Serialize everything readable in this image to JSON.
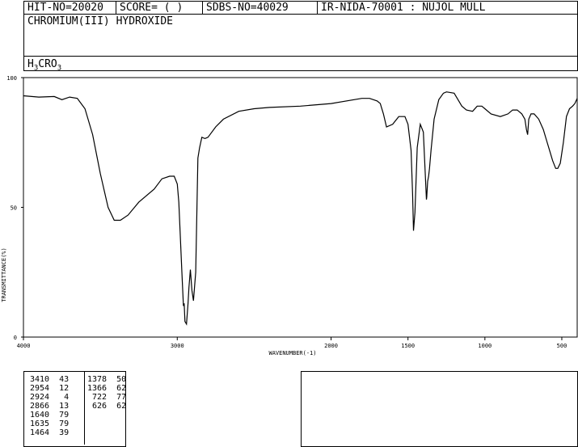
{
  "header": {
    "hit_no": "HIT-NO=20020",
    "score": "SCORE=  (   )",
    "sdbs_no": "SDBS-NO=40029",
    "ir_code": "IR-NIDA-70001 : NUJOL MULL"
  },
  "compound": {
    "name": "CHROMIUM(III) HYDROXIDE",
    "formula_main": "H",
    "formula_sub1": "3",
    "formula_mid": "CRO",
    "formula_sub2": "3"
  },
  "chart_data": {
    "type": "line",
    "xlabel": "WAVENUMBER(-1)",
    "ylabel": "TRANSMITTANCE(%)",
    "xlim": [
      4000,
      400
    ],
    "ylim": [
      0,
      100
    ],
    "x_ticks": [
      4000,
      3000,
      2000,
      1500,
      1000,
      500
    ],
    "y_ticks": [
      0,
      50,
      100
    ],
    "grid": false,
    "legend": "none",
    "series": [
      {
        "x": [
          4000,
          3900,
          3800,
          3750,
          3700,
          3650,
          3600,
          3550,
          3500,
          3450,
          3410,
          3370,
          3320,
          3250,
          3150,
          3100,
          3050,
          3020,
          3000,
          2990,
          2970,
          2960,
          2955,
          2950,
          2940,
          2930,
          2924,
          2915,
          2905,
          2895,
          2880,
          2866,
          2855,
          2840,
          2820,
          2800,
          2750,
          2700,
          2600,
          2500,
          2400,
          2200,
          2000,
          1800,
          1750,
          1700,
          1680,
          1660,
          1640,
          1600,
          1560,
          1520,
          1500,
          1480,
          1470,
          1464,
          1455,
          1440,
          1420,
          1400,
          1390,
          1380,
          1378,
          1372,
          1366,
          1360,
          1350,
          1330,
          1300,
          1270,
          1250,
          1200,
          1180,
          1150,
          1120,
          1080,
          1050,
          1020,
          1000,
          960,
          900,
          850,
          820,
          790,
          760,
          740,
          730,
          722,
          715,
          700,
          680,
          650,
          620,
          600,
          580,
          560,
          540,
          526,
          510,
          490,
          470,
          450,
          430,
          415,
          400
        ],
        "y": [
          93,
          92.5,
          92.7,
          91.5,
          92.5,
          92,
          88,
          78,
          63,
          50,
          45,
          45,
          47,
          52,
          57,
          61,
          62,
          62,
          59,
          52,
          25,
          12,
          13,
          6,
          5,
          13,
          19,
          26,
          18,
          14,
          25,
          69,
          73,
          77,
          76.5,
          77,
          81,
          84,
          87,
          88,
          88.5,
          89,
          90,
          92,
          92,
          91,
          90,
          86,
          81,
          82,
          85,
          85,
          82,
          72,
          55,
          41,
          48,
          73,
          82,
          79,
          66,
          53,
          54,
          60,
          62,
          65,
          72,
          84,
          91.5,
          94,
          94.5,
          94,
          92,
          89,
          87.5,
          87,
          89,
          89,
          88,
          86,
          85,
          86,
          87.5,
          87.5,
          86,
          84,
          80,
          78,
          84,
          86,
          86,
          84,
          80,
          76,
          72,
          68,
          65,
          65,
          67,
          75,
          85,
          88,
          89,
          90,
          92
        ]
      }
    ]
  },
  "peaks": {
    "col1": "3410  43\n2954  12\n2924   4\n2866  13\n1640  79\n1635  79\n1464  39",
    "col2": "1378  50\n1366  62\n 722  77\n 626  62"
  }
}
